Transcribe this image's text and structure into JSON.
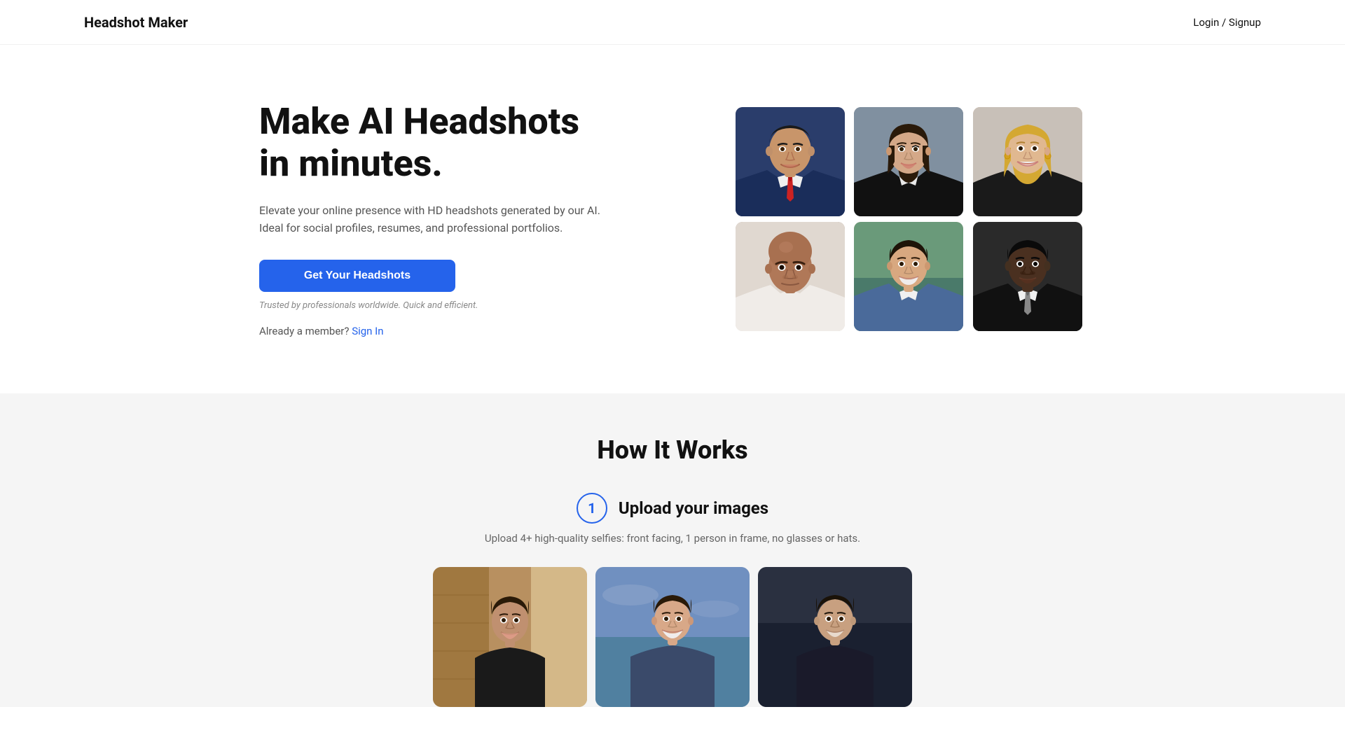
{
  "header": {
    "logo": "Headshot Maker",
    "nav_login": "Login / Signup"
  },
  "hero": {
    "title_line1": "Make AI Headshots",
    "title_line2": "in minutes.",
    "description": "Elevate your online presence with HD headshots generated by our AI. Ideal for social profiles, resumes, and professional portfolios.",
    "cta_button": "Get Your Headshots",
    "trusted_text": "Trusted by professionals worldwide. Quick and efficient.",
    "member_prompt": "Already a member?",
    "sign_in_link": "Sign In"
  },
  "how_it_works": {
    "section_title": "How It Works",
    "step1": {
      "number": "1",
      "title": "Upload your images",
      "description": "Upload 4+ high-quality selfies: front facing, 1 person in frame, no glasses or hats."
    }
  },
  "headshots": [
    {
      "id": "hs1",
      "alt": "Man in blue suit with red tie"
    },
    {
      "id": "hs2",
      "alt": "Woman in black blazer"
    },
    {
      "id": "hs3",
      "alt": "Woman with blonde hair smiling"
    },
    {
      "id": "hs4",
      "alt": "Bald man in white shirt"
    },
    {
      "id": "hs5",
      "alt": "Young man in blue blazer"
    },
    {
      "id": "hs6",
      "alt": "Man in dark suit with tie"
    }
  ],
  "upload_examples": [
    {
      "id": "up1",
      "alt": "Casual selfie indoors"
    },
    {
      "id": "up2",
      "alt": "Outdoor selfie smiling"
    },
    {
      "id": "up3",
      "alt": "Casual portrait"
    }
  ],
  "colors": {
    "primary": "#2563eb",
    "bg_section": "#f5f5f5",
    "text_dark": "#111111",
    "text_muted": "#555555"
  }
}
